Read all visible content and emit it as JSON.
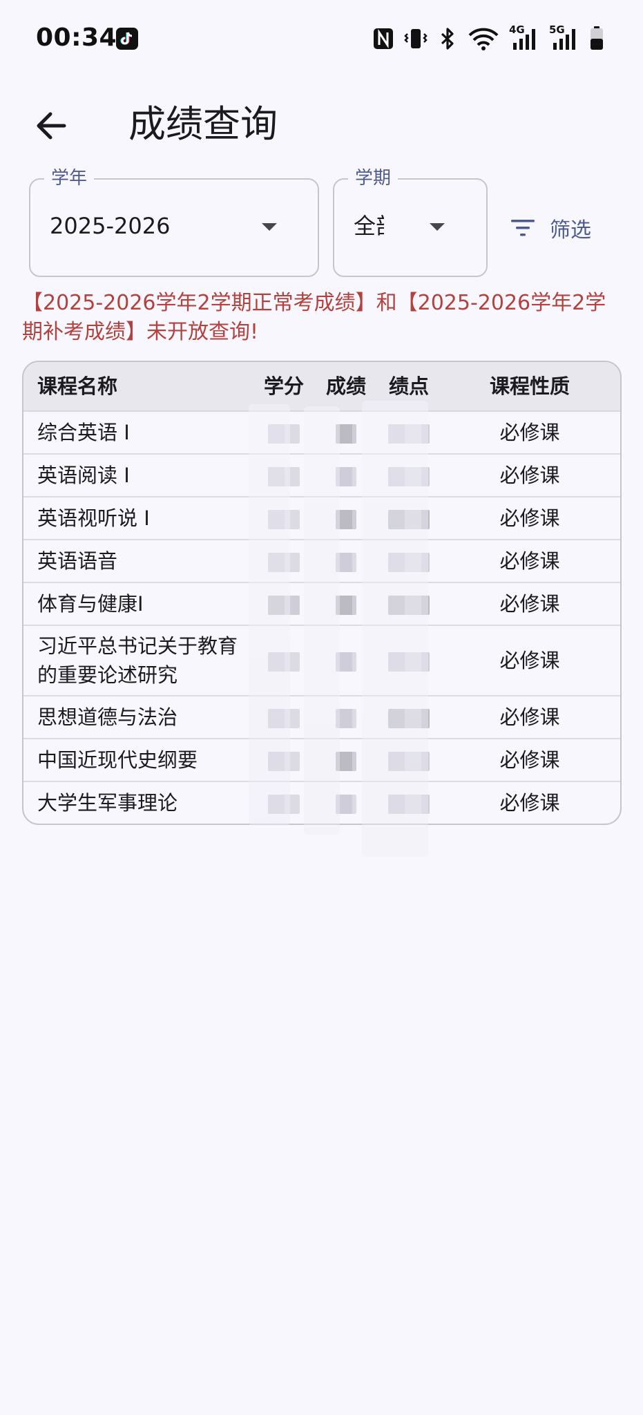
{
  "status_bar": {
    "time": "00:34",
    "icons": [
      "tiktok-icon",
      "nfc-icon",
      "vibrate-icon",
      "bluetooth-icon",
      "wifi-icon",
      "signal-4g-icon",
      "signal-5g-icon",
      "battery-icon"
    ],
    "network_4g": "4G",
    "network_5g": "5G"
  },
  "app_bar": {
    "title": "成绩查询"
  },
  "filters": {
    "year_label": "学年",
    "year_value": "2025-2026",
    "term_label": "学期",
    "term_value": "全部",
    "filter_button": "筛选"
  },
  "notice": "【2025-2026学年2学期正常考成绩】和【2025-2026学年2学期补考成绩】未开放查询!",
  "table": {
    "headers": {
      "name": "课程名称",
      "credit": "学分",
      "score": "成绩",
      "gpa": "绩点",
      "type": "课程性质"
    },
    "rows": [
      {
        "name": "综合英语 I",
        "type": "必修课"
      },
      {
        "name": "英语阅读 I",
        "type": "必修课"
      },
      {
        "name": "英语视听说 I",
        "type": "必修课"
      },
      {
        "name": "英语语音",
        "type": "必修课"
      },
      {
        "name": "体育与健康I",
        "type": "必修课"
      },
      {
        "name": "习近平总书记关于教育的重要论述研究",
        "type": "必修课"
      },
      {
        "name": "思想道德与法治",
        "type": "必修课"
      },
      {
        "name": "中国近现代史纲要",
        "type": "必修课"
      },
      {
        "name": "大学生军事理论",
        "type": "必修课"
      }
    ]
  },
  "colors": {
    "background": "#f8f7fd",
    "accent": "#4e5b92",
    "notice": "#b3413d",
    "border": "#c6c5cf"
  }
}
